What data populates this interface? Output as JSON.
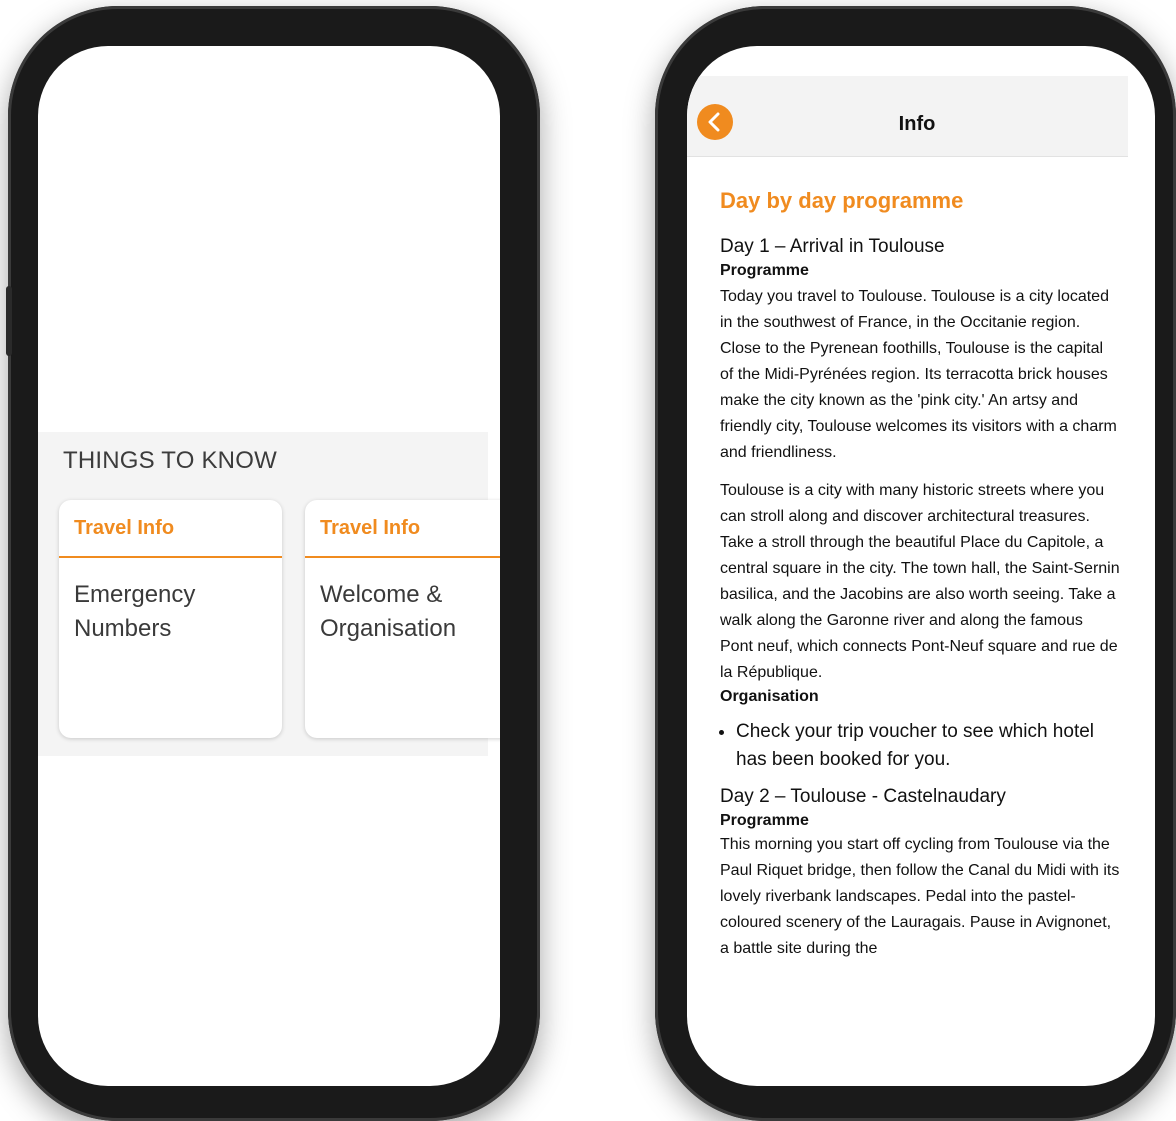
{
  "left_screen": {
    "section_title": "THINGS TO KNOW",
    "cards": [
      {
        "category": "Travel Info",
        "title_line1": "Emergency",
        "title_line2": "Numbers"
      },
      {
        "category": "Travel Info",
        "title_line1": "Welcome &",
        "title_line2": "Organisation"
      }
    ]
  },
  "right_screen": {
    "header": {
      "title": "Info",
      "back_icon": "chevron-left-icon"
    },
    "heading": "Day by day programme",
    "day1": {
      "title": "Day 1 – Arrival in Toulouse",
      "programme_label": "Programme",
      "paragraph1": "Today you travel to Toulouse. Toulouse is a city located in the southwest of France, in the Occitanie region. Close to the Pyrenean foothills, Toulouse is the capital of the Midi-Pyrénées region. Its terracotta brick houses make the city known as the 'pink city.' An artsy and friendly city, Toulouse welcomes its visitors with a charm and friendliness.",
      "paragraph2": "Toulouse is a city with many historic streets where you can stroll along and discover architectural treasures. Take a stroll through the beautiful Place du Capitole, a central square in the city. The town hall, the Saint-Sernin basilica, and the Jacobins are also worth seeing. Take a walk along the Garonne river and along the famous Pont neuf, which connects Pont-Neuf square and rue de la République.",
      "organisation_label": "Organisation",
      "bullet": "Check your trip voucher to see which hotel has been booked for you."
    },
    "day2": {
      "title": "Day 2 – Toulouse - Castelnaudary",
      "programme_label": "Programme",
      "paragraph": "This morning you start off cycling from Toulouse via the Paul Riquet bridge, then follow the Canal du Midi with its lovely riverbank landscapes. Pedal into the pastel-coloured scenery of the Lauragais. Pause in Avignonet, a battle site during the"
    }
  },
  "colors": {
    "accent": "#f08b1f",
    "phone_frame": "#1a1a1a",
    "band_bg": "#f4f4f4"
  }
}
